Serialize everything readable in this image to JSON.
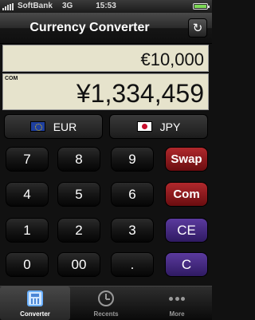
{
  "status_bar": {
    "carrier": "SoftBank",
    "network": "3G",
    "time": "15:53"
  },
  "header": {
    "title": "Currency Converter",
    "refresh_icon": "refresh-icon"
  },
  "display": {
    "source_amount": "€10,000",
    "result_amount": "¥1,334,459",
    "result_tag": "COM"
  },
  "currencies": {
    "from": {
      "code": "EUR",
      "flag_icon": "eu-flag-icon"
    },
    "to": {
      "code": "JPY",
      "flag_icon": "japan-flag-icon"
    }
  },
  "keypad": {
    "k7": "7",
    "k8": "8",
    "k9": "9",
    "swap": "Swap",
    "k4": "4",
    "k5": "5",
    "k6": "6",
    "com": "Com",
    "k1": "1",
    "k2": "2",
    "k3": "3",
    "ce": "CE",
    "k0": "0",
    "k00": "00",
    "dot": ".",
    "clear": "C"
  },
  "tabs": [
    {
      "label": "Converter",
      "icon": "calculator-icon",
      "active": true
    },
    {
      "label": "Recents",
      "icon": "clock-icon",
      "active": false
    },
    {
      "label": "More",
      "icon": "more-icon",
      "active": false
    }
  ],
  "colors": {
    "display_bg": "#e6e3cc",
    "swap_com": "#b0282c",
    "ce_c": "#5b3a9e",
    "tab_highlight": "#6ab0ff"
  }
}
